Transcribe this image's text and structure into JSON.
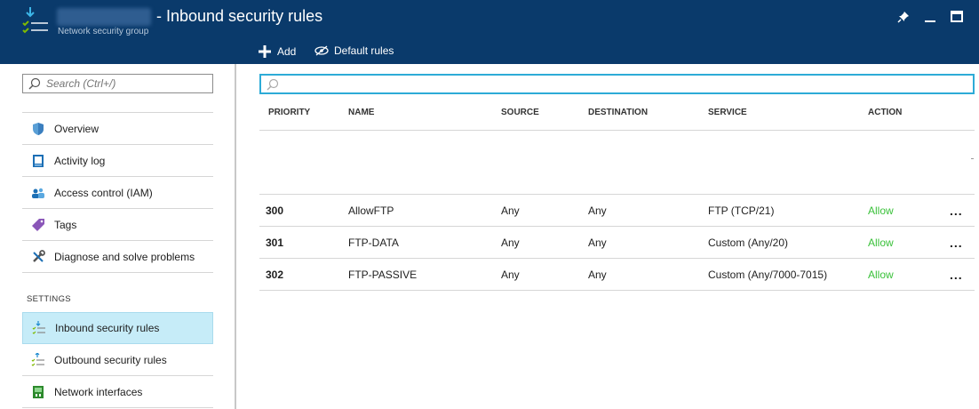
{
  "header": {
    "title": "- Inbound security rules",
    "subtitle": "Network security group",
    "icon": "network-security-group-icon",
    "color": "#0a3a6b"
  },
  "commands": {
    "add_label": "Add",
    "default_rules_label": "Default rules"
  },
  "leftnav": {
    "search_placeholder": "Search (Ctrl+/)",
    "items": [
      {
        "label": "Overview",
        "icon": "shield-icon"
      },
      {
        "label": "Activity log",
        "icon": "activity-log-icon"
      },
      {
        "label": "Access control (IAM)",
        "icon": "people-icon"
      },
      {
        "label": "Tags",
        "icon": "tag-icon"
      },
      {
        "label": "Diagnose and solve problems",
        "icon": "wrench-icon"
      }
    ],
    "settings_label": "SETTINGS",
    "settings_items": [
      {
        "label": "Inbound security rules",
        "icon": "inbound-rules-icon",
        "active": true
      },
      {
        "label": "Outbound security rules",
        "icon": "outbound-rules-icon"
      },
      {
        "label": "Network interfaces",
        "icon": "network-interface-icon"
      }
    ]
  },
  "table": {
    "filter_value": "",
    "columns": [
      "PRIORITY",
      "NAME",
      "SOURCE",
      "DESTINATION",
      "SERVICE",
      "ACTION"
    ],
    "rows": [
      {
        "priority": "300",
        "name": "AllowFTP",
        "source": "Any",
        "destination": "Any",
        "service": "FTP (TCP/21)",
        "action": "Allow"
      },
      {
        "priority": "301",
        "name": "FTP-DATA",
        "source": "Any",
        "destination": "Any",
        "service": "Custom (Any/20)",
        "action": "Allow"
      },
      {
        "priority": "302",
        "name": "FTP-PASSIVE",
        "source": "Any",
        "destination": "Any",
        "service": "Custom (Any/7000-7015)",
        "action": "Allow"
      }
    ],
    "more_label": "...",
    "allow_color": "#3ac13a"
  }
}
